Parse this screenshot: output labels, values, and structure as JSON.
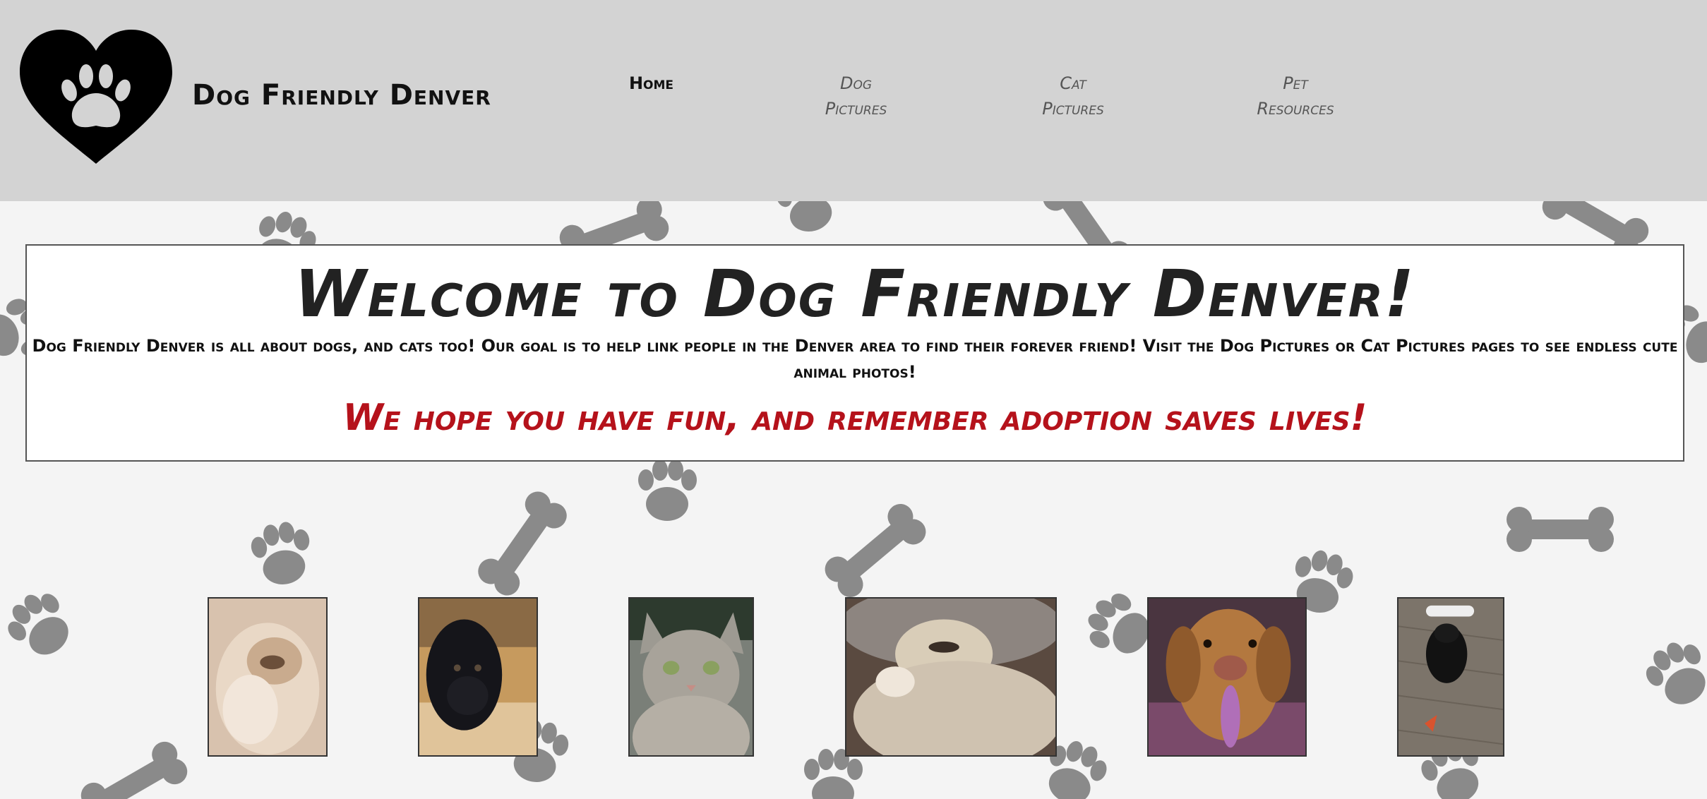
{
  "header": {
    "site_name": "Dog Friendly Denver",
    "logo_icon": "paw-heart-icon",
    "nav": [
      {
        "line1": "Home",
        "line2": "",
        "active": true
      },
      {
        "line1": "Dog",
        "line2": "Pictures",
        "active": false
      },
      {
        "line1": "Cat",
        "line2": "Pictures",
        "active": false
      },
      {
        "line1": "Pet",
        "line2": "Resources",
        "active": false
      }
    ]
  },
  "welcome": {
    "title": "Welcome to Dog Friendly Denver!",
    "body": "Dog Friendly Denver is all about dogs, and cats too! Our goal is to help link people in the Denver area to find their forever friend! Visit the Dog Pictures or Cat Pictures pages to see endless cute animal photos!",
    "tagline": "We hope you have fun, and remember adoption saves lives!"
  },
  "gallery": [
    {
      "subject": "fluffy-cream-cat"
    },
    {
      "subject": "black-spaniel-dog"
    },
    {
      "subject": "grey-tabby-cat"
    },
    {
      "subject": "persian-cat-in-blanket"
    },
    {
      "subject": "yellow-lab-dog"
    },
    {
      "subject": "black-cat-on-floor"
    }
  ],
  "colors": {
    "header_bg": "#d3d3d3",
    "page_bg": "#f4f4f4",
    "pattern": "#8a8a8a",
    "tagline": "#b5121b"
  }
}
